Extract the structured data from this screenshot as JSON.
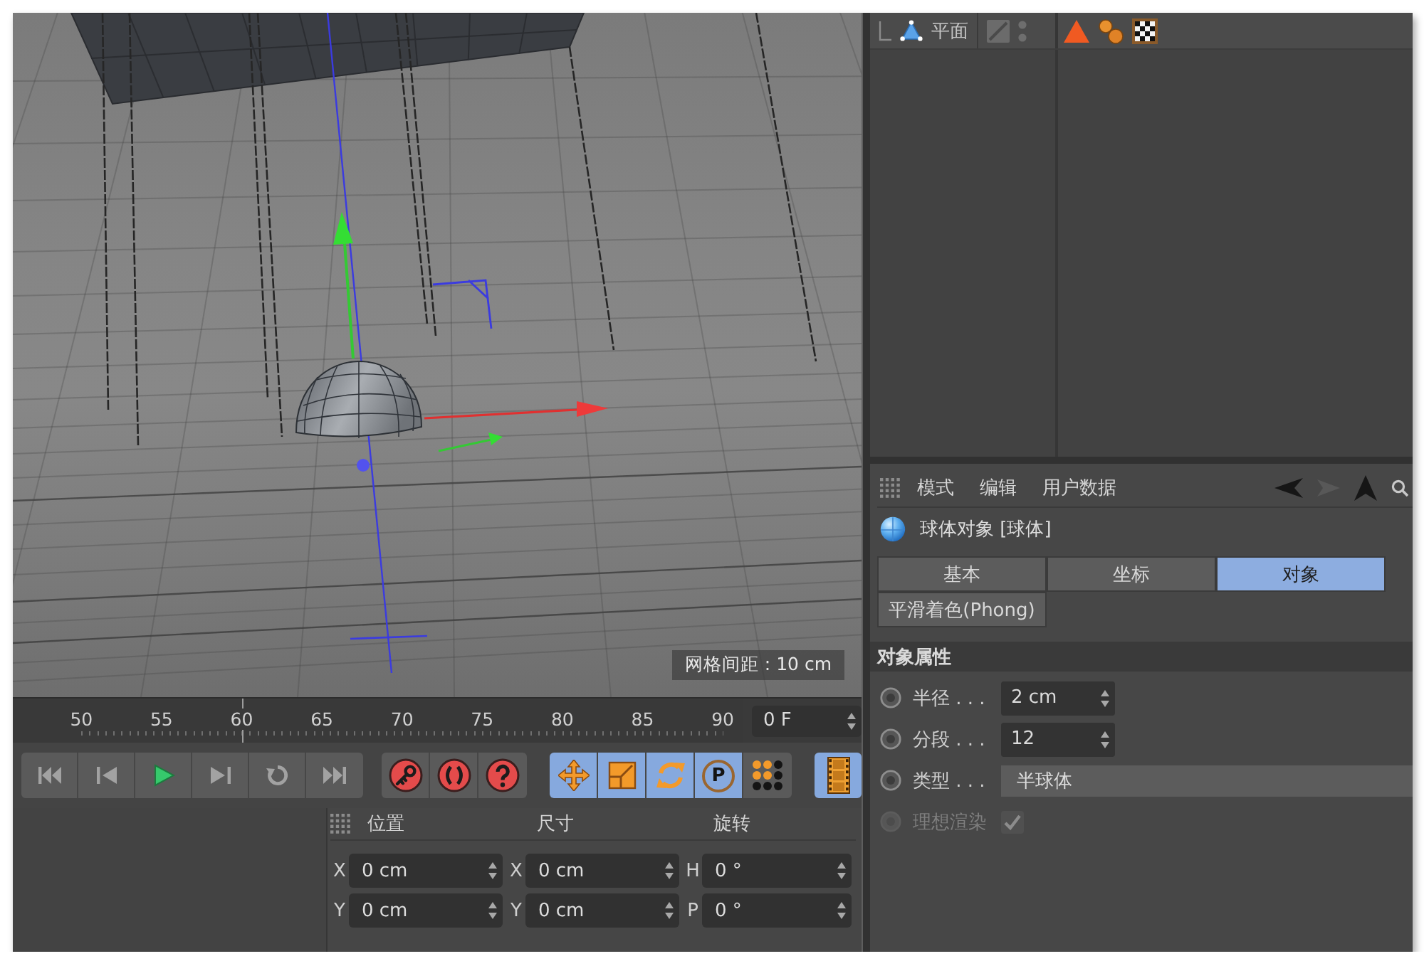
{
  "viewport": {
    "grid_spacing": "网格间距 : 10 cm"
  },
  "object_manager": {
    "objects": [
      {
        "name": "平面",
        "tags": [
          {
            "kind": "triangle"
          },
          {
            "kind": "balls"
          },
          {
            "kind": "checker"
          }
        ]
      }
    ]
  },
  "attributes": {
    "menu": [
      "模式",
      "编辑",
      "用户数据"
    ],
    "title": "球体对象 [球体]",
    "tabs": [
      {
        "label": "基本",
        "selected": false
      },
      {
        "label": "坐标",
        "selected": false
      },
      {
        "label": "对象",
        "selected": true
      },
      {
        "label": "平滑着色(Phong)",
        "selected": false
      }
    ],
    "section": "对象属性",
    "params": [
      {
        "kind": "number",
        "label": "半径 . . .",
        "value": "2 cm",
        "keyframe": false,
        "disabled": false
      },
      {
        "kind": "number",
        "label": "分段 . . .",
        "value": "12",
        "keyframe": false,
        "disabled": false
      },
      {
        "kind": "dropdown",
        "label": "类型 . . .",
        "value": "半球体",
        "keyframe": false,
        "disabled": false
      },
      {
        "kind": "checkbox",
        "label": "理想渲染",
        "checked": true,
        "keyframe": false,
        "disabled": true
      }
    ]
  },
  "timeline": {
    "frames": [
      {
        "label": "50",
        "playhead": false
      },
      {
        "label": "55",
        "playhead": false
      },
      {
        "label": "60",
        "playhead": true
      },
      {
        "label": "65",
        "playhead": false
      },
      {
        "label": "70",
        "playhead": false
      },
      {
        "label": "75",
        "playhead": false
      },
      {
        "label": "80",
        "playhead": false
      },
      {
        "label": "85",
        "playhead": false
      },
      {
        "label": "90",
        "playhead": false
      }
    ],
    "current_frame": "0 F"
  },
  "transport": {
    "playback": [
      {
        "kind": "start"
      },
      {
        "kind": "prev_frame"
      },
      {
        "kind": "play"
      },
      {
        "kind": "next_frame"
      },
      {
        "kind": "loop"
      },
      {
        "kind": "end"
      }
    ],
    "keys": [
      {
        "kind": "record"
      },
      {
        "kind": "autokey"
      },
      {
        "kind": "help"
      }
    ],
    "modes": [
      {
        "kind": "move",
        "on": true
      },
      {
        "kind": "scale",
        "on": true
      },
      {
        "kind": "rotate",
        "on": true
      },
      {
        "kind": "param",
        "label": "P",
        "on": true
      },
      {
        "kind": "points",
        "on": false
      },
      {
        "kind": "film",
        "on": true
      }
    ]
  },
  "coordinates": {
    "headers": [
      "位置",
      "尺寸",
      "旋转"
    ],
    "rows": [
      [
        {
          "axis": "X",
          "value": "0 cm"
        },
        {
          "axis": "X",
          "value": "0 cm"
        },
        {
          "axis": "H",
          "value": "0 °"
        }
      ],
      [
        {
          "axis": "Y",
          "value": "0 cm"
        },
        {
          "axis": "Y",
          "value": "0 cm"
        },
        {
          "axis": "P",
          "value": "0 °"
        }
      ]
    ]
  }
}
